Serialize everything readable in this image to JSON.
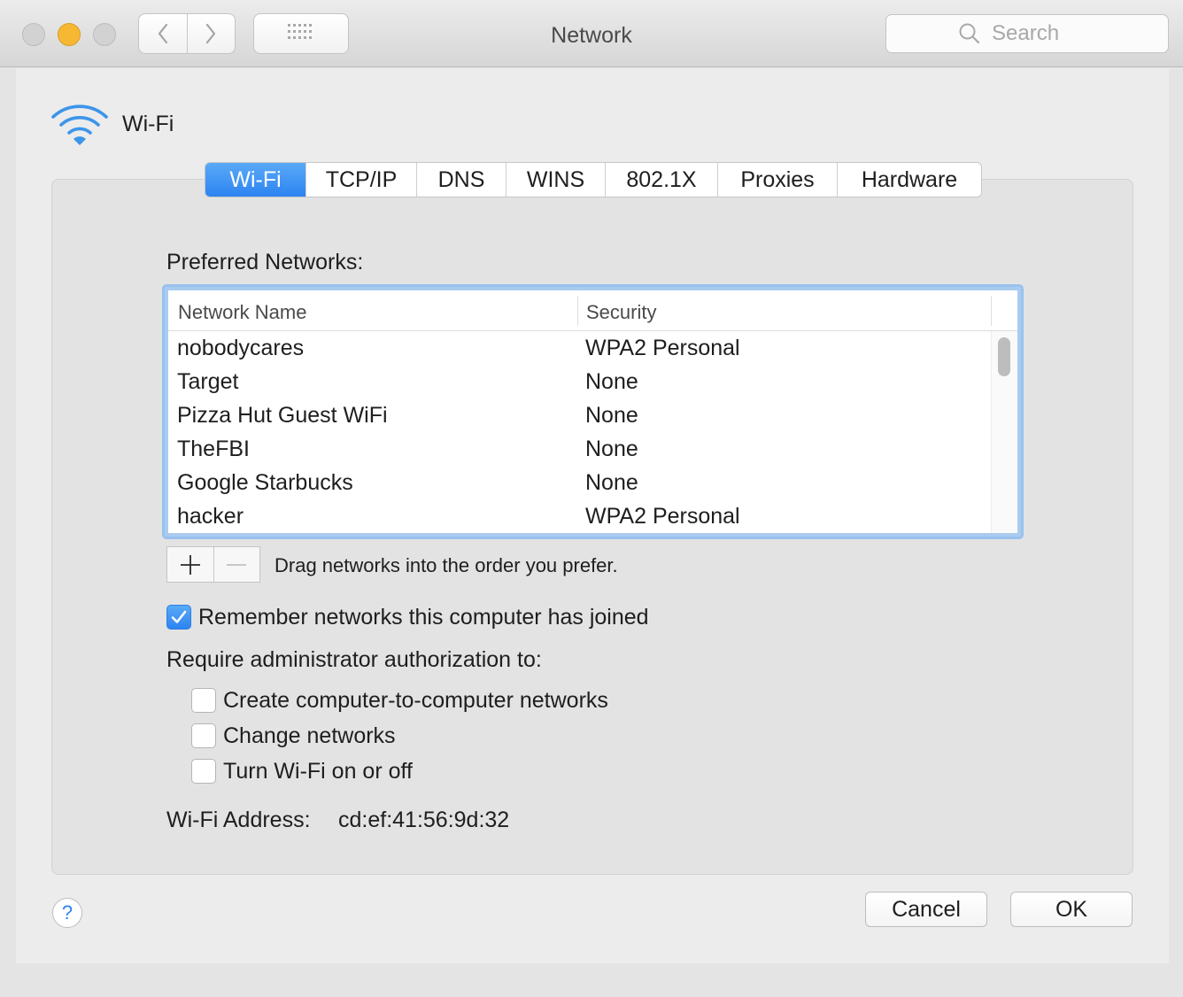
{
  "window": {
    "title": "Network",
    "search_placeholder": "Search"
  },
  "interface": {
    "name": "Wi-Fi"
  },
  "tabs": [
    {
      "label": "Wi-Fi",
      "active": true
    },
    {
      "label": "TCP/IP",
      "active": false
    },
    {
      "label": "DNS",
      "active": false
    },
    {
      "label": "WINS",
      "active": false
    },
    {
      "label": "802.1X",
      "active": false
    },
    {
      "label": "Proxies",
      "active": false
    },
    {
      "label": "Hardware",
      "active": false
    }
  ],
  "preferred": {
    "label": "Preferred Networks:",
    "columns": [
      "Network Name",
      "Security"
    ],
    "rows": [
      {
        "name": "nobodycares",
        "security": "WPA2 Personal"
      },
      {
        "name": "Target",
        "security": "None"
      },
      {
        "name": "Pizza Hut Guest WiFi",
        "security": "None"
      },
      {
        "name": "TheFBI",
        "security": "None"
      },
      {
        "name": "Google Starbucks",
        "security": "None"
      },
      {
        "name": "hacker",
        "security": "WPA2 Personal"
      }
    ],
    "drag_hint": "Drag networks into the order you prefer."
  },
  "options": {
    "remember": {
      "label": "Remember networks this computer has joined",
      "checked": true
    },
    "require_label": "Require administrator authorization to:",
    "require": [
      {
        "label": "Create computer-to-computer networks",
        "checked": false
      },
      {
        "label": "Change networks",
        "checked": false
      },
      {
        "label": "Turn Wi-Fi on or off",
        "checked": false
      }
    ]
  },
  "address": {
    "label": "Wi-Fi Address:",
    "value": "cd:ef:41:56:9d:32"
  },
  "buttons": {
    "help": "?",
    "cancel": "Cancel",
    "ok": "OK"
  },
  "colors": {
    "accent": "#2c84f0",
    "minimize": "#f6b833"
  }
}
